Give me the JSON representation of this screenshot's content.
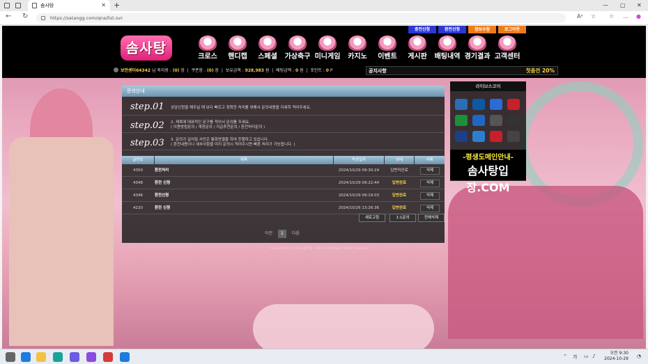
{
  "browser": {
    "tab_title": "솜사탕",
    "url": "https://satangg.com/qna/list.svc"
  },
  "header": {
    "logo": "솜사탕",
    "top_buttons": [
      {
        "label": "충전신청",
        "color": "#2b37d6"
      },
      {
        "label": "환전신청",
        "color": "#2b37d6"
      },
      {
        "label": "정보수정",
        "color": "#f07c18"
      },
      {
        "label": "로그아웃",
        "color": "#f07c18"
      }
    ],
    "menu": [
      "크로스",
      "핸디캡",
      "스페셜",
      "가상축구",
      "미니게임",
      "카지노",
      "이벤트",
      "게시판",
      "배팅내역",
      "경기결과",
      "고객센터"
    ],
    "info": {
      "nick": "보안센터64342",
      "nick_suffix": "님 죽지왕 :",
      "level": "(0)",
      "coupon_label": "쿠폰함 :",
      "coupon": "(0)",
      "money_label": "보유금액 :",
      "money": "928,983",
      "bet_label": "배팅금액 :",
      "bet": "0",
      "point_label": "포인트 :",
      "point": "0",
      "unit_won": "원",
      "unit_jang": "장",
      "unit_p": "P"
    },
    "notice_title": "공지사항",
    "promo": "첫충전 20%"
  },
  "board": {
    "title": "문의안내",
    "steps": [
      {
        "no": "step.01",
        "lines": [
          "상담신청을 해주실 때 보다 빠르고 정확한 처리를 위해서 문의내용을 자세히 적어주세요."
        ]
      },
      {
        "no": "step.02",
        "lines": [
          "2. 제목에 대표적인 문구를 적어서 문의를 주세요.",
          "( 이용방법문의 / 계정문의 / 지급추천문의 / 환전처리문의 )"
        ]
      },
      {
        "no": "step.03",
        "lines": [
          "3. 문의가 길어질 사안은 통화연결을 하여 진행하고 있습니다.",
          "( 환전내용이나 세부사항을 미리 문의시 적어주시면 빠른 처리가 가능합니다. )"
        ]
      }
    ],
    "columns": [
      "글번호",
      "제목",
      "작성일자",
      "상태",
      "삭제"
    ],
    "rows": [
      {
        "no": "4350",
        "subject": "환전처리",
        "date": "2024/10/29 09:30:24",
        "status": "답변미완료",
        "delete": "삭제"
      },
      {
        "no": "4348",
        "subject": "환전 신청",
        "date": "2024/10/29 09:22:44",
        "status": "답변완료",
        "delete": "삭제"
      },
      {
        "no": "4346",
        "subject": "환전신청",
        "date": "2024/10/29 09:19:03",
        "status": "답변완료",
        "delete": "삭제"
      },
      {
        "no": "4220",
        "subject": "환전 신청",
        "date": "2024/10/26 13:26:36",
        "status": "답변완료",
        "delete": "삭제"
      }
    ],
    "buttons": [
      "새로고침",
      "1:1문의",
      "전체삭제"
    ],
    "pager": {
      "prev": "이전",
      "current": "1",
      "next": "다음"
    },
    "copyright": "Copyright © 2015 솜사탕 · All intellectual rights reserved"
  },
  "live": {
    "title": "라이브스코어",
    "games": [
      {
        "name": "loading-icon",
        "color": "#2a6db8"
      },
      {
        "name": "7M",
        "color": "#0c5aa6"
      },
      {
        "name": "livescore",
        "color": "#2c6bd6"
      },
      {
        "name": "bet365",
        "color": "#c8202a"
      },
      {
        "name": "nowgoal",
        "color": "#1d8f3a"
      },
      {
        "name": "FIFA",
        "color": "#2166c2"
      },
      {
        "name": "soccer-ball",
        "color": "#555555"
      },
      {
        "name": "uefa",
        "color": "#333333"
      },
      {
        "name": "mlb",
        "color": "#1c3f8a"
      },
      {
        "name": "kbo",
        "color": "#2a7fcf"
      },
      {
        "name": "nba",
        "color": "#c8202a"
      },
      {
        "name": "nhl",
        "color": "#444444"
      }
    ],
    "banner_line1": "-평생도메인안내-",
    "banner_line2": "솜사탕입장.COM"
  },
  "taskbar": {
    "time": "오전 9:30",
    "date": "2024-10-29",
    "lang": "가"
  }
}
